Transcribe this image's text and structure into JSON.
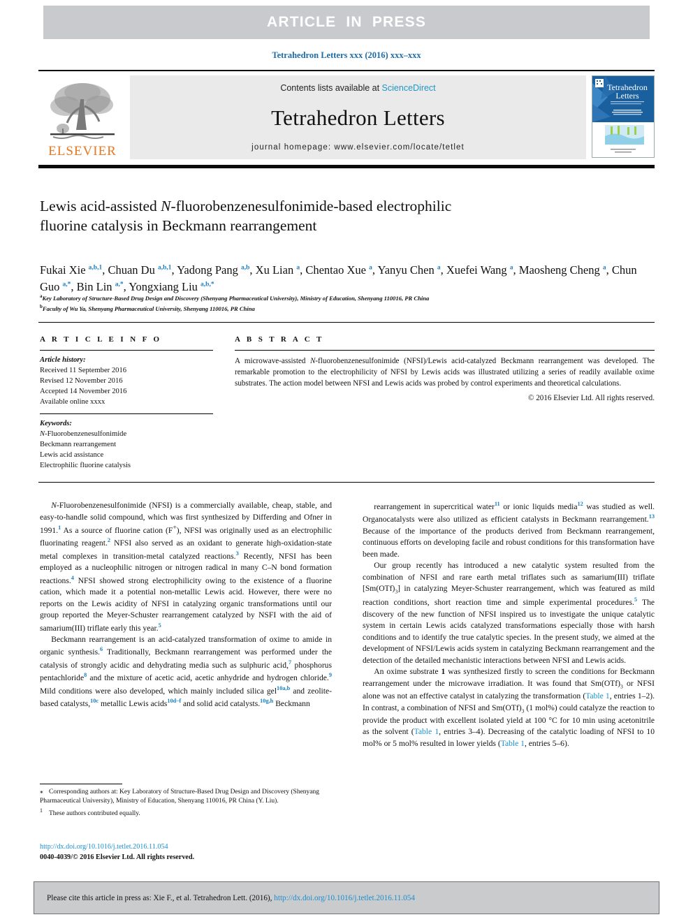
{
  "banner": {
    "label": "ARTICLE  IN  PRESS"
  },
  "citation_line": {
    "text": "Tetrahedron Letters xxx (2016) xxx–xxx"
  },
  "masthead": {
    "contents_prefix": "Contents lists available at ",
    "contents_link": "ScienceDirect",
    "journal_name": "Tetrahedron Letters",
    "homepage": "journal homepage: www.elsevier.com/locate/tetlet",
    "publisher": "ELSEVIER",
    "cover_title_line1": "Tetrahedron",
    "cover_title_line2": "Letters"
  },
  "article": {
    "title_line1": "Lewis acid-assisted ",
    "title_italic": "N",
    "title_line1b": "-fluorobenzenesulfonimide-based electrophilic",
    "title_line2": "fluorine catalysis in Beckmann rearrangement",
    "authors_html": "Fukai Xie <sup>a,b,1</sup>, Chuan Du <sup>a,b,1</sup>, Yadong Pang <sup>a,b</sup>, Xu Lian <sup>a</sup>, Chentao Xue <sup>a</sup>, Yanyu Chen <sup>a</sup>, Xuefei Wang <sup>a</sup>, Maosheng Cheng <sup>a</sup>, Chun Guo <sup>a,*</sup>, Bin Lin <sup>a,*</sup>, Yongxiang Liu <sup>a,b,*</sup>",
    "affiliation_a": "Key Laboratory of Structure-Based Drug Design and Discovery (Shenyang Pharmaceutical University), Ministry of Education, Shenyang 110016, PR China",
    "affiliation_b": "Faculty of Wu Ya, Shenyang Pharmaceutical University, Shenyang 110016, PR China"
  },
  "article_info": {
    "heading": "A R T I C L E   I N F O",
    "history_label": "Article history:",
    "history": [
      "Received 11 September 2016",
      "Revised 12 November 2016",
      "Accepted 14 November 2016",
      "Available online xxxx"
    ],
    "keywords_label": "Keywords:",
    "keywords": [
      "N-Fluorobenzenesulfonimide",
      "Beckmann rearrangement",
      "Lewis acid assistance",
      "Electrophilic fluorine catalysis"
    ]
  },
  "abstract": {
    "heading": "A B S T R A C T",
    "text": "A microwave-assisted N-fluorobenzenesulfonimide (NFSI)/Lewis acid-catalyzed Beckmann rearrangement was developed. The remarkable promotion to the electrophilicity of NFSI by Lewis acids was illustrated utilizing a series of readily available oxime substrates. The action model between NFSI and Lewis acids was probed by control experiments and theoretical calculations.",
    "copyright": "© 2016 Elsevier Ltd. All rights reserved."
  },
  "body": {
    "left_p1": "N-Fluorobenzenesulfonimide (NFSI) is a commercially available, cheap, stable, and easy-to-handle solid compound, which was first synthesized by Differding and Ofner in 1991.[1] As a source of fluorine cation (F+), NFSI was originally used as an electrophilic fluorinating reagent.[2] NFSI also served as an oxidant to generate high-oxidation-state metal complexes in transition-metal catalyzed reactions.[3] Recently, NFSI has been employed as a nucleophilic nitrogen or nitrogen radical in many C–N bond formation reactions.[4] NFSI showed strong electrophilicity owing to the existence of a fluorine cation, which made it a potential non-metallic Lewis acid. However, there were no reports on the Lewis acidity of NFSI in catalyzing organic transformations until our group reported the Meyer-Schuster rearrangement catalyzed by NSFI with the aid of samarium(III) triflate early this year.[5]",
    "left_p2": "Beckmann rearrangement is an acid-catalyzed transformation of oxime to amide in organic synthesis.[6] Traditionally, Beckmann rearrangement was performed under the catalysis of strongly acidic and dehydrating media such as sulphuric acid,[7] phosphorus pentachloride[8] and the mixture of acetic acid, acetic anhydride and hydrogen chloride.[9] Mild conditions were also developed, which mainly included silica gel[10a,b] and zeolite-based catalysts,[10c] metallic Lewis acids[10d–f] and solid acid catalysts.[10g,h] Beckmann",
    "right_p1": "rearrangement in supercritical water[11] or ionic liquids media[12] was studied as well. Organocatalysts were also utilized as efficient catalysts in Beckmann rearrangement.[13] Because of the importance of the products derived from Beckmann rearrangement, continuous efforts on developing facile and robust conditions for this transformation have been made.",
    "right_p2": "Our group recently has introduced a new catalytic system resulted from the combination of NFSI and rare earth metal triflates such as samarium(III) triflate [Sm(OTf)3] in catalyzing Meyer-Schuster rearrangement, which was featured as mild reaction conditions, short reaction time and simple experimental procedures.[5] The discovery of the new function of NFSI inspired us to investigate the unique catalytic system in certain Lewis acids catalyzed transformations especially those with harsh conditions and to identify the true catalytic species. In the present study, we aimed at the development of NFSI/Lewis acids system in catalyzing Beckmann rearrangement and the detection of the detailed mechanistic interactions between NFSI and Lewis acids.",
    "right_p3": "An oxime substrate 1 was synthesized firstly to screen the conditions for Beckmann rearrangement under the microwave irradiation. It was found that Sm(OTf)3 or NFSI alone was not an effective catalyst in catalyzing the transformation (Table 1, entries 1–2). In contrast, a combination of NFSI and Sm(OTf)3 (1 mol%) could catalyze the reaction to provide the product with excellent isolated yield at 100 °C for 10 min using acetonitrile as the solvent (Table 1, entries 3–4). Decreasing of the catalytic loading of NFSI to 10 mol% or 5 mol% resulted in lower yields (Table 1, entries 5–6)."
  },
  "footnotes": {
    "corresponding": "Corresponding authors at: Key Laboratory of Structure-Based Drug Design and Discovery (Shenyang Pharmaceutical University), Ministry of Education, Shenyang 110016, PR China (Y. Liu).",
    "equal": "These authors contributed equally.",
    "marker_star": "⁎",
    "marker_one": "1"
  },
  "doi_block": {
    "doi": "http://dx.doi.org/10.1016/j.tetlet.2016.11.054",
    "issn": "0040-4039/© 2016 Elsevier Ltd. All rights reserved."
  },
  "footer": {
    "prefix": "Please cite this article in press as: Xie F., et al. Tetrahedron Lett. (2016), ",
    "link": "http://dx.doi.org/10.1016/j.tetlet.2016.11.054"
  },
  "colors": {
    "link": "#1b8fd0",
    "banner_bg": "#c8cace",
    "elsevier_orange": "#e87722",
    "ref_blue": "#1b7fc0"
  }
}
